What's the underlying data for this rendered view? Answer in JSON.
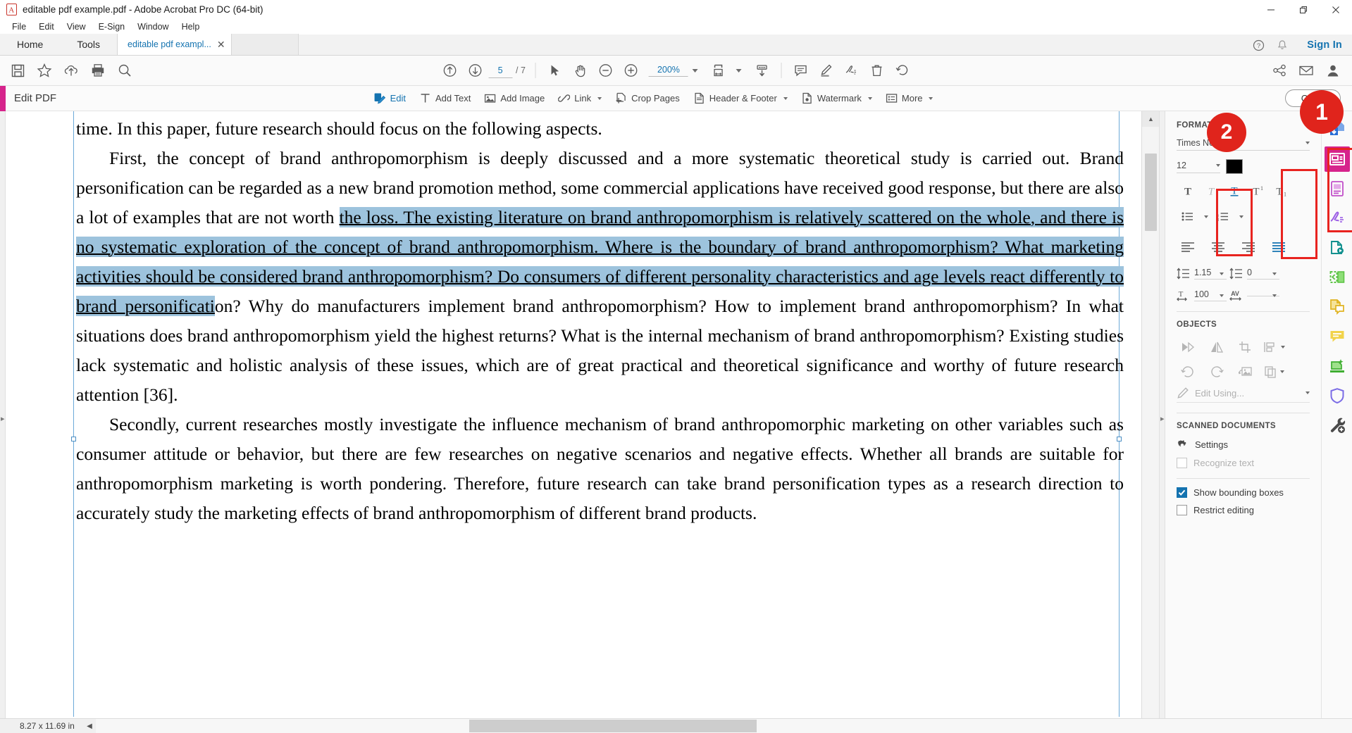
{
  "window": {
    "title": "editable pdf example.pdf - Adobe Acrobat Pro DC (64-bit)",
    "minimize": "─",
    "maximize": "❐",
    "close": "✕"
  },
  "menubar": {
    "items": [
      "File",
      "Edit",
      "View",
      "E-Sign",
      "Window",
      "Help"
    ]
  },
  "tabstrip": {
    "home": "Home",
    "tools": "Tools",
    "doc_tab": "editable pdf exampl...",
    "doc_tab_close": "✕",
    "help_icon": "help-circle-icon",
    "bell_icon": "bell-icon",
    "sign_in": "Sign In"
  },
  "main_toolbar": {
    "left_tools": [
      "save-icon",
      "star-icon",
      "upload-cloud-icon",
      "print-icon",
      "search-icon"
    ],
    "prev_page_icon": "arrow-up-circle-icon",
    "next_page_icon": "arrow-down-circle-icon",
    "page_current": "5",
    "page_total": "/ 7",
    "select_icon": "cursor-arrow-icon",
    "hand_icon": "hand-icon",
    "zoom_out_icon": "zoom-out-icon",
    "zoom_in_icon": "zoom-in-icon",
    "zoom_value": "200%",
    "fit_page_icon": "fit-page-icon",
    "scroll_mode_icon": "scroll-mode-icon",
    "comment_icon": "comment-icon",
    "highlight_icon": "highlight-icon",
    "sign_icon": "sign-icon",
    "delete_icon": "trash-icon",
    "undo_icon": "undo-icon",
    "right_tools": [
      "share-link-icon",
      "email-icon",
      "account-icon"
    ]
  },
  "editbar": {
    "title": "Edit PDF",
    "actions": [
      {
        "label": "Edit",
        "icon": "edit-pdf-icon",
        "active": true,
        "has_caret": false
      },
      {
        "label": "Add Text",
        "icon": "add-text-icon",
        "active": false,
        "has_caret": false
      },
      {
        "label": "Add Image",
        "icon": "add-image-icon",
        "active": false,
        "has_caret": false
      },
      {
        "label": "Link",
        "icon": "link-icon",
        "active": false,
        "has_caret": true
      },
      {
        "label": "Crop Pages",
        "icon": "crop-pages-icon",
        "active": false,
        "has_caret": false
      },
      {
        "label": "Header & Footer",
        "icon": "header-footer-icon",
        "active": false,
        "has_caret": true
      },
      {
        "label": "Watermark",
        "icon": "watermark-icon",
        "active": false,
        "has_caret": true
      },
      {
        "label": "More",
        "icon": "more-list-icon",
        "active": false,
        "has_caret": true
      }
    ],
    "close_label": "Close"
  },
  "document": {
    "paragraphs": [
      {
        "indent": false,
        "runs": [
          {
            "text": "time. In this paper, future research should focus on the following aspects.",
            "selected": false
          }
        ]
      },
      {
        "indent": true,
        "runs": [
          {
            "text": "First, the concept of brand anthropomorphism is deeply discussed and a more systematic theoretical study is carried out. Brand personification can be regarded as a new brand promotion method, some commercial applications have received good response, but there are also a lot of examples that are not worth ",
            "selected": false
          },
          {
            "text": "the loss. The existing literature on brand anthropomorphism is relatively scattered on the whole, and there is no systematic exploration of the concept of brand anthropomorphism. Where is the boundary of brand anthropomorphism? What marketing activities should be considered brand anthropomorphism? Do consumers of different personality characteristics and age levels react differently to brand personificati",
            "selected": true
          },
          {
            "text": "on? Why do manufacturers implement brand anthropomorphism? How to implement brand anthropomorphism? In what situations does brand anthropomorphism yield the highest returns? What is the internal mechanism of  brand anthropomorphism? Existing studies lack systematic and holistic analysis of these issues, which are of great practical and theoretical significance and worthy of future research attention [36].",
            "selected": false
          }
        ]
      },
      {
        "indent": true,
        "runs": [
          {
            "text": "Secondly, current researches mostly investigate the influence mechanism of brand anthropomorphic marketing on other variables such as consumer attitude or behavior, but there are few researches on negative scenarios and negative effects. Whether all brands are suitable for anthropomorphism marketing is worth pondering. Therefore, future research can take brand personification types as a research direction to accurately study the marketing effects of brand anthropomorphism of different brand products.",
            "selected": false
          }
        ]
      }
    ],
    "selection_color": "#9dc3dd"
  },
  "right_panel": {
    "format": {
      "heading": "FORMAT",
      "font_family": "Times Ne",
      "font_size": "12",
      "color_swatch": "#000000",
      "style_buttons": [
        {
          "name": "bold-button",
          "glyph": "T",
          "state": "normal"
        },
        {
          "name": "italic-button",
          "glyph": "T",
          "state": "dim"
        },
        {
          "name": "underline-button",
          "glyph": "T",
          "state": "active"
        },
        {
          "name": "superscript-button",
          "glyph": "T¹",
          "state": "normal"
        },
        {
          "name": "subscript-button",
          "glyph": "T₁",
          "state": "normal"
        }
      ],
      "bullet_list": "bullet-list-icon",
      "numbered_list": "numbered-list-icon",
      "align_left": "align-left-icon",
      "align_center": "align-center-icon",
      "align_right": "align-right-icon",
      "align_justify": "align-justify-icon",
      "line_spacing_value": "1.15",
      "paragraph_spacing_value": "0",
      "horizontal_scale_value": "100",
      "character_spacing_value": ""
    },
    "objects": {
      "heading": "OBJECTS",
      "flip_horizontal": "flip-horizontal-icon",
      "flip_vertical": "flip-vertical-icon",
      "crop_image": "crop-image-icon",
      "arrange": "arrange-icon",
      "rotate_ccw": "rotate-counterclockwise-icon",
      "rotate_cw": "rotate-clockwise-icon",
      "replace_image": "replace-image-icon",
      "copy_object": "copy-object-icon",
      "edit_using_label": "Edit Using..."
    },
    "scanned": {
      "heading": "SCANNED DOCUMENTS",
      "settings_label": "Settings",
      "settings_icon": "gear-icon",
      "recognize_text_label": "Recognize text",
      "recognize_text_checked": false
    },
    "options": [
      {
        "label": "Show bounding boxes",
        "checked": true
      },
      {
        "label": "Restrict editing",
        "checked": false
      }
    ]
  },
  "rail": {
    "items": [
      {
        "name": "export-pdf-icon",
        "selected": false
      },
      {
        "name": "edit-pdf-icon",
        "selected": true
      },
      {
        "name": "create-pdf-icon",
        "selected": false
      },
      {
        "name": "fill-sign-icon",
        "selected": false
      },
      {
        "name": "send-for-signature-icon",
        "selected": false
      },
      {
        "name": "organize-pages-icon",
        "selected": false
      },
      {
        "name": "compare-files-icon",
        "selected": false
      },
      {
        "name": "comment-icon",
        "selected": false
      },
      {
        "name": "scan-ocr-icon",
        "selected": false
      },
      {
        "name": "protect-icon",
        "selected": false
      },
      {
        "name": "more-tools-icon",
        "selected": false
      }
    ]
  },
  "statusbar": {
    "page_size": "8.27 x 11.69 in",
    "scroll_left_icon": "chevron-left-icon"
  },
  "annotations": [
    {
      "id": "1",
      "label": "1"
    },
    {
      "id": "2",
      "label": "2"
    }
  ]
}
